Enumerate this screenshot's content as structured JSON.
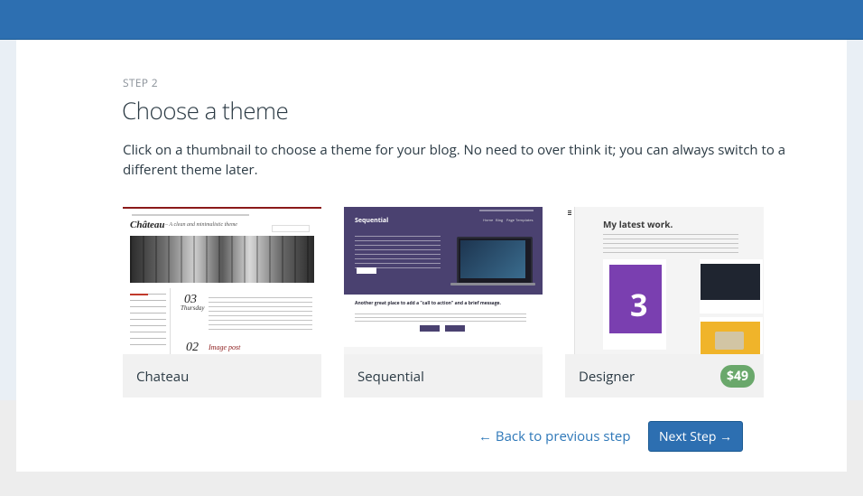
{
  "step_label": "STEP 2",
  "page_title": "Choose a theme",
  "description": "Click on a thumbnail to choose a theme for your blog. No need to over think it; you can always switch to a different theme later.",
  "themes": [
    {
      "name": "Chateau",
      "preview": {
        "site_title": "Château",
        "tagline": "– A clean and minimalistic theme",
        "post_day": "03",
        "post_weekday": "Thursday",
        "post2_day": "02",
        "post_title": "Image post"
      }
    },
    {
      "name": "Sequential",
      "preview": {
        "site_title": "Sequential",
        "nav": [
          "Home",
          "Blog",
          "Page Templates"
        ],
        "cta": "Another great place to add a \"call to action\" and a brief message."
      }
    },
    {
      "name": "Designer",
      "price": "$49",
      "preview": {
        "headline": "My latest work.",
        "card_number": "3"
      }
    }
  ],
  "footer": {
    "back_label": "← Back to previous step",
    "next_label": "Next Step →"
  },
  "colors": {
    "topbar": "#2d6fb1",
    "primary_button": "#2d6fb1",
    "link": "#2d77b8",
    "price_badge": "#6aa86b",
    "sequential_header": "#4a4170"
  }
}
